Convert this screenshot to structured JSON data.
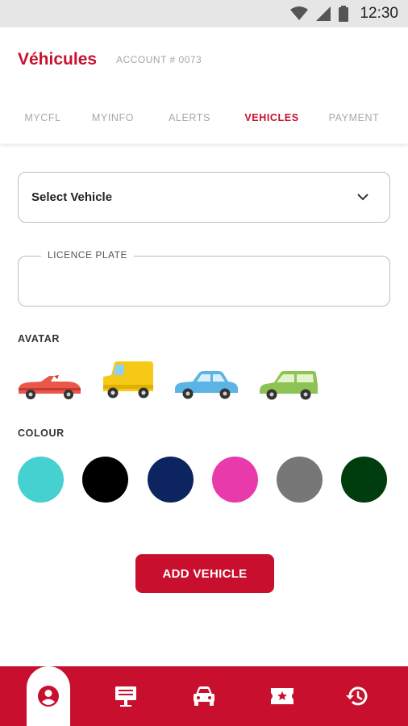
{
  "status_bar": {
    "time": "12:30",
    "icons": [
      "wifi-icon",
      "signal-icon",
      "battery-icon"
    ]
  },
  "header": {
    "title": "Véhicules",
    "account": "ACCOUNT # 0073"
  },
  "tabs": [
    {
      "label": "MYCFL",
      "active": false
    },
    {
      "label": "MYINFO",
      "active": false
    },
    {
      "label": "ALERTS",
      "active": false
    },
    {
      "label": "VEHICLES",
      "active": true
    },
    {
      "label": "PAYMENT",
      "active": false
    }
  ],
  "form": {
    "select_vehicle": {
      "value": "Select Vehicle",
      "icon": "chevron-down-icon"
    },
    "licence_plate": {
      "label": "LICENCE PLATE",
      "value": ""
    },
    "avatar_label": "AVATAR",
    "avatars": [
      "red-convertible",
      "yellow-van",
      "blue-sedan",
      "green-wagon"
    ],
    "colour_label": "COLOUR",
    "colours": [
      "#45d1cf",
      "#000000",
      "#0c2560",
      "#e93aab",
      "#777777",
      "#003d0e"
    ],
    "add_button": "ADD VEHICLE"
  },
  "bottom_nav": {
    "items": [
      "account-icon",
      "billboard-icon",
      "car-icon",
      "ticket-icon",
      "history-icon"
    ],
    "active_index": 0
  },
  "colors": {
    "accent": "#c8102e"
  }
}
